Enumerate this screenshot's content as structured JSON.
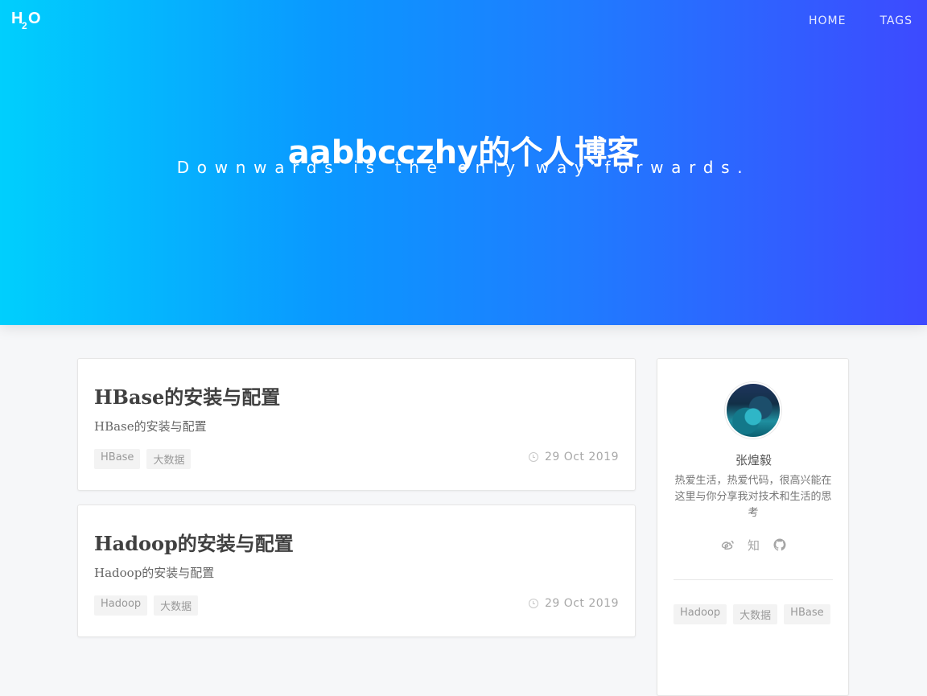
{
  "header": {
    "logo_text": "H2O",
    "nav": [
      "HOME",
      "TAGS"
    ]
  },
  "hero": {
    "title": "aabbcczhy的个人博客",
    "subtitle": "Downwards is the only way forwards."
  },
  "posts": [
    {
      "title": "HBase的安装与配置",
      "excerpt": "HBase的安装与配置",
      "tags": [
        "HBase",
        "大数据"
      ],
      "date": "29 Oct 2019"
    },
    {
      "title": "Hadoop的安装与配置",
      "excerpt": "Hadoop的安装与配置",
      "tags": [
        "Hadoop",
        "大数据"
      ],
      "date": "29 Oct 2019"
    }
  ],
  "sidebar": {
    "author": "张煌毅",
    "bio": "热爱生活，热爱代码，很高兴能在这里与你分享我对技术和生活的思考",
    "socials": {
      "weibo": "weibo-icon",
      "zhihu": "知",
      "github": "github-icon"
    },
    "tags": [
      "Hadoop",
      "大数据",
      "HBase"
    ]
  },
  "colors": {
    "hero_start": "#00cffd",
    "hero_end": "#3d4aff",
    "page_bg": "#f6f7f9",
    "text_dark": "#404040",
    "muted": "#999999"
  }
}
